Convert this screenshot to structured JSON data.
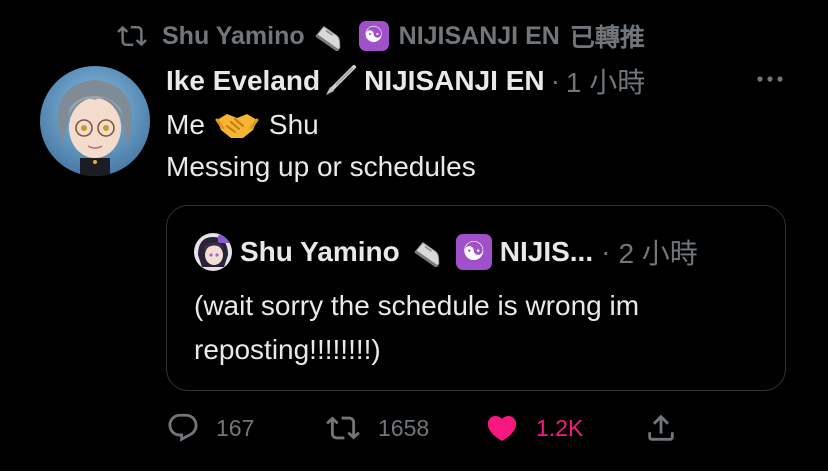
{
  "retweet": {
    "retweeter_name": "Shu Yamino",
    "org_label": "NIJISANJI EN",
    "retweeted_label": "已轉推",
    "icons": [
      "retweet-icon",
      "sneaker-emoji-icon",
      "yin-yang-emoji-icon"
    ]
  },
  "tweet": {
    "author_name": "Ike Eveland",
    "org_label": "NIJISANJI EN",
    "separator": "·",
    "time": "1 小時",
    "line1_before": "Me",
    "line1_after": "Shu",
    "line2": "Messing up or schedules",
    "icons": [
      "fountain-pen-emoji-icon",
      "handshake-emoji-icon",
      "more-options-icon"
    ]
  },
  "quote": {
    "author_name": "Shu Yamino",
    "org_label_truncated": "NIJIS...",
    "separator": "·",
    "time": "2 小時",
    "line1": "(wait sorry the schedule is wrong im",
    "line2": "reposting!!!!!!!!)"
  },
  "actions": {
    "replies": "167",
    "retweets": "1658",
    "likes": "1.2K",
    "liked": true,
    "like_color": "#f91880",
    "muted_color": "#71767b"
  }
}
